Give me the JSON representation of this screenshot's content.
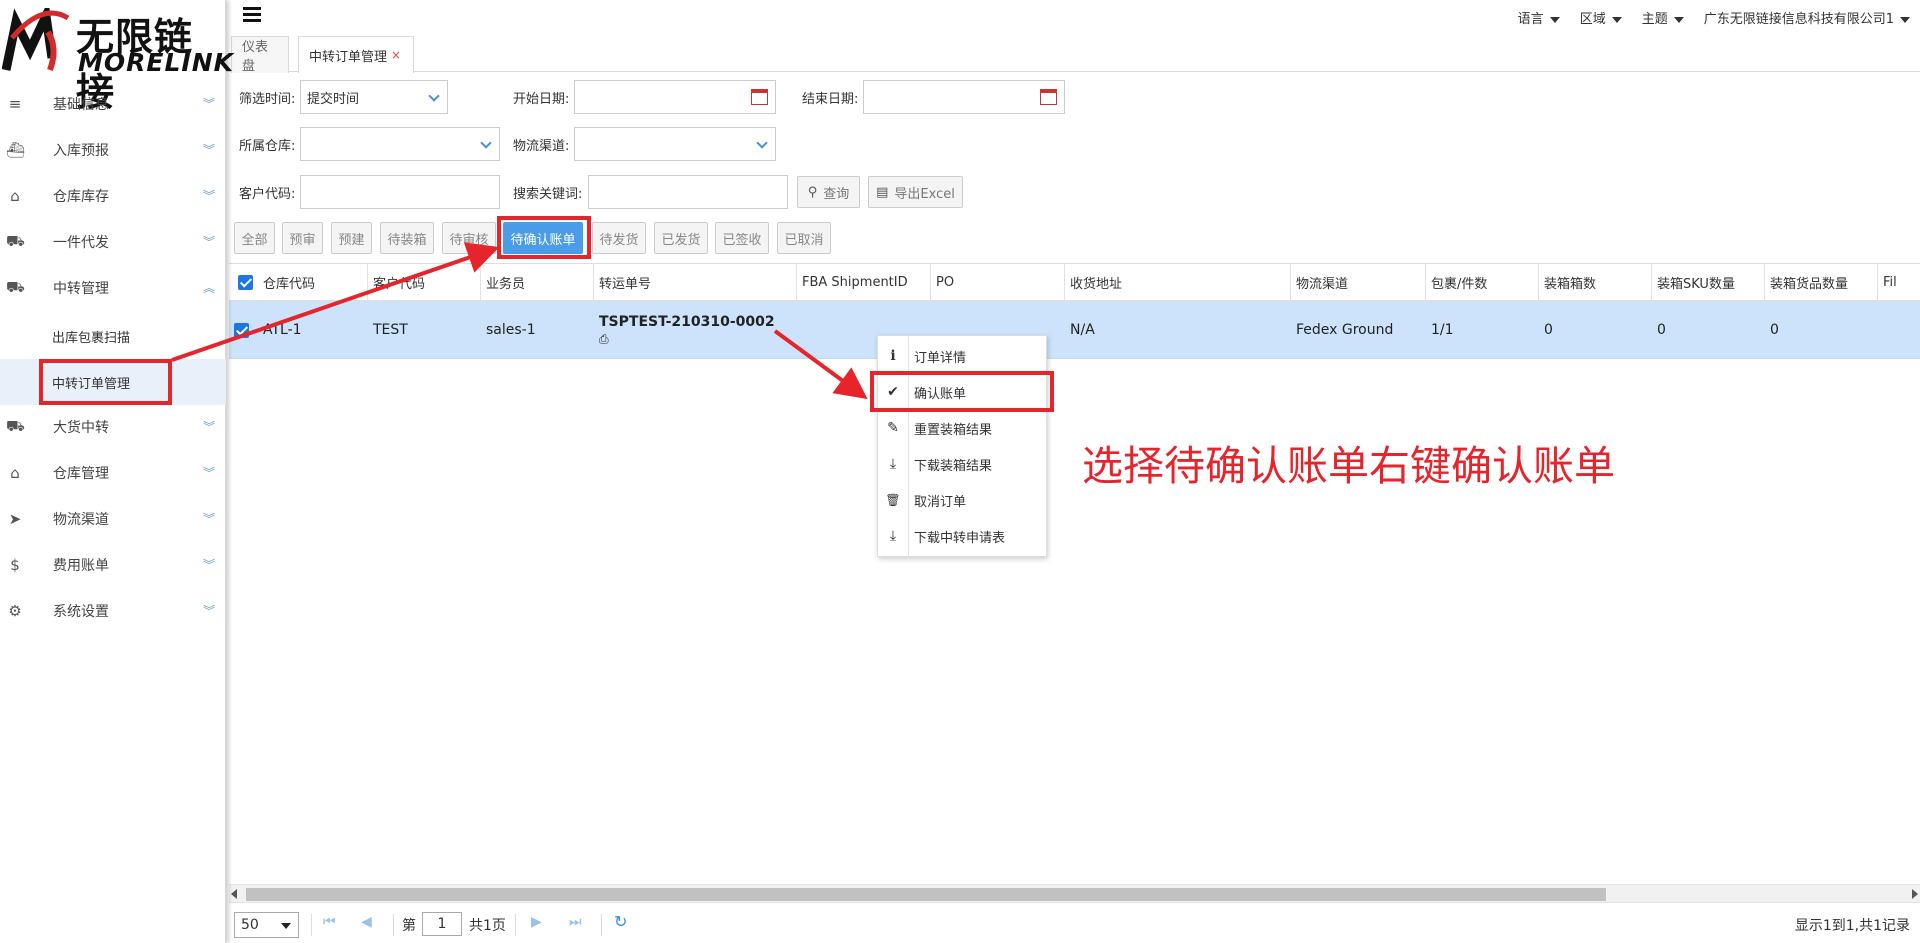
{
  "logo": {
    "cn": "无限链接",
    "en": "MORELINK"
  },
  "sidebar": {
    "items": [
      {
        "label": "基础信息",
        "icon": "list-icon",
        "glyph": "≡"
      },
      {
        "label": "入库预报",
        "icon": "ship-icon",
        "glyph": "⛴"
      },
      {
        "label": "仓库库存",
        "icon": "inbox-icon",
        "glyph": "⌂"
      },
      {
        "label": "一件代发",
        "icon": "truck-icon",
        "glyph": "⛟"
      },
      {
        "label": "中转管理",
        "icon": "truck-icon",
        "glyph": "⛟"
      },
      {
        "label": "大货中转",
        "icon": "truck-icon",
        "glyph": "⛟"
      },
      {
        "label": "仓库管理",
        "icon": "home-icon",
        "glyph": "⌂"
      },
      {
        "label": "物流渠道",
        "icon": "pointer-icon",
        "glyph": "➤"
      },
      {
        "label": "费用账单",
        "icon": "dollar-icon",
        "glyph": "$"
      },
      {
        "label": "系统设置",
        "icon": "gear-icon",
        "glyph": "⚙"
      }
    ],
    "sub_items": [
      {
        "label": "出库包裹扫描"
      },
      {
        "label": "中转订单管理"
      }
    ]
  },
  "header": {
    "language": "语言",
    "region": "区域",
    "theme": "主题",
    "company": "广东无限链接信息科技有限公司1"
  },
  "tabs": [
    {
      "label": "仪表盘"
    },
    {
      "label": "中转订单管理",
      "close": "×"
    }
  ],
  "filters": {
    "filter_time_label": "筛选时间:",
    "filter_time_value": "提交时间",
    "start_date_label": "开始日期:",
    "end_date_label": "结束日期:",
    "warehouse_label": "所属仓库:",
    "channel_label": "物流渠道:",
    "customer_code_label": "客户代码:",
    "keyword_label": "搜索关键词:",
    "search_button": "查询",
    "export_button": "导出Excel"
  },
  "status_buttons": [
    "全部",
    "预审",
    "预建",
    "待装箱",
    "待审核",
    "待确认账单",
    "待发货",
    "已发货",
    "已签收",
    "已取消"
  ],
  "table": {
    "headers": [
      "仓库代码",
      "客户代码",
      "业务员",
      "转运单号",
      "FBA ShipmentID",
      "PO",
      "收货地址",
      "物流渠道",
      "包裹/件数",
      "装箱箱数",
      "装箱SKU数量",
      "装箱货品数量",
      "Fil"
    ],
    "row": {
      "warehouse": "ATL-1",
      "customer": "TEST",
      "sales": "sales-1",
      "transfer_no": "TSPTEST-210310-0002",
      "fba": "",
      "po": "",
      "address": "N/A",
      "channel": "Fedex Ground",
      "parcels": "1/1",
      "boxes": "0",
      "sku_qty": "0",
      "goods_qty": "0"
    }
  },
  "context_menu": {
    "items": [
      {
        "label": "订单详情",
        "icon": "info-icon",
        "glyph": "i"
      },
      {
        "label": "确认账单",
        "icon": "check-icon",
        "glyph": "✔"
      },
      {
        "label": "重置装箱结果",
        "icon": "edit-icon",
        "glyph": "✎"
      },
      {
        "label": "下载装箱结果",
        "icon": "download-icon",
        "glyph": "⤓"
      },
      {
        "label": "取消订单",
        "icon": "trash-icon",
        "glyph": "🗑"
      },
      {
        "label": "下载中转申请表",
        "icon": "download-icon",
        "glyph": "⤓"
      }
    ]
  },
  "annotation": {
    "text": "选择待确认账单右键确认账单",
    "color": "#e5242b"
  },
  "pagination": {
    "page_size": "50",
    "page_prefix": "第",
    "page_current": "1",
    "page_suffix": "共1页",
    "info": "显示1到1,共1记录"
  },
  "colors": {
    "accent": "#4b9ce8",
    "row_selected": "#cce3fb",
    "annotation_red": "#e5242b"
  }
}
